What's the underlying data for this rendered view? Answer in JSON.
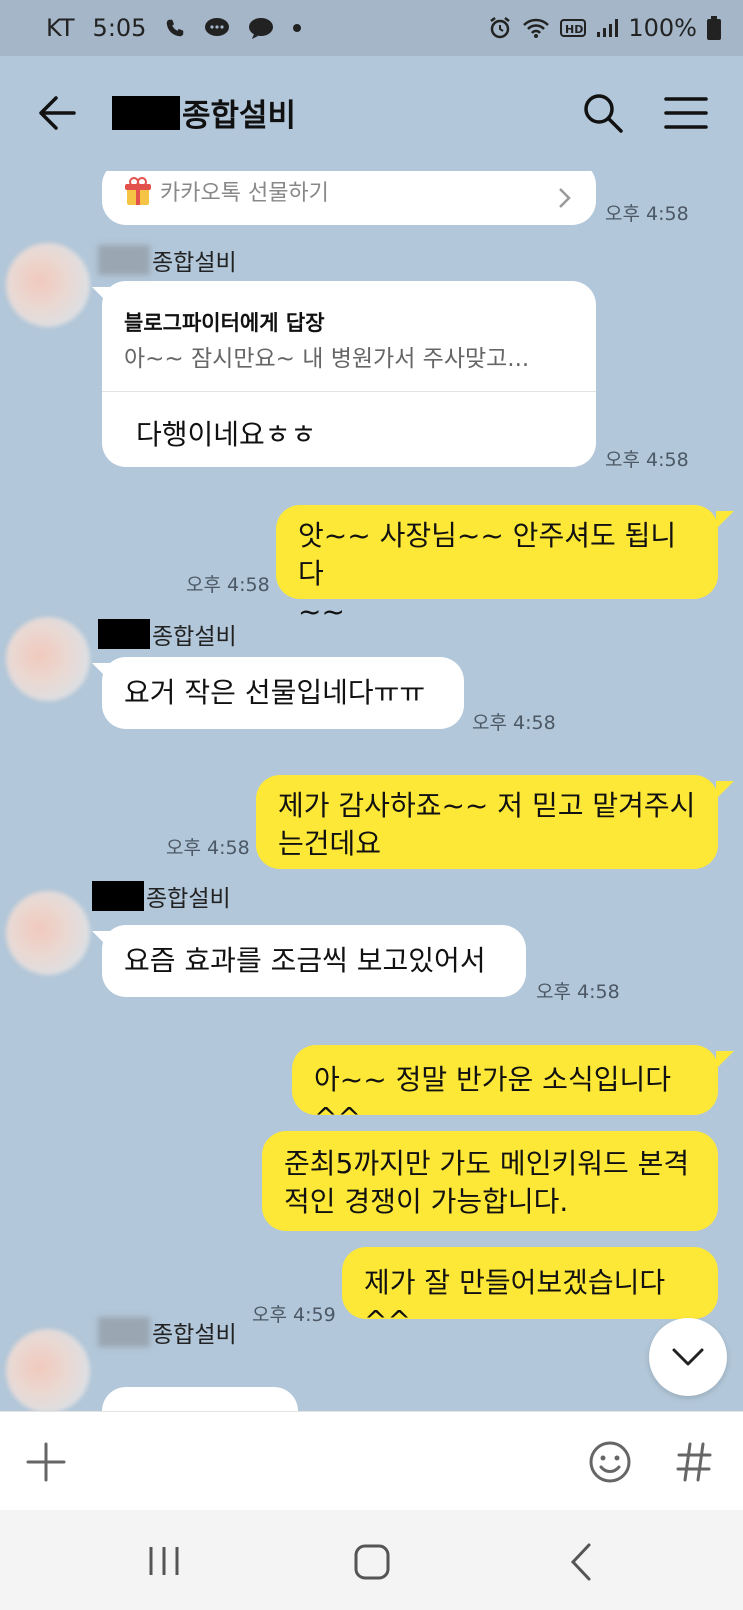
{
  "status_bar": {
    "carrier": "KT",
    "time": "5:05",
    "battery": "100%"
  },
  "header": {
    "room_name": "종합설비"
  },
  "messages": {
    "gift_link": "카카오톡 선물하기",
    "gift_time": "오후 4:58",
    "m1_sender": "종합설비",
    "m1_reply_to": "블로그파이터에게 답장",
    "m1_reply_preview": "아~~ 잠시만요~ 내 병원가서 주사맞고...",
    "m1_text": "다행이네요ㅎㅎ",
    "m1_time": "오후 4:58",
    "m2_line1": "앗~~ 사장님~~ 안주셔도 됩니다",
    "m2_line2": "~~",
    "m2_time": "오후 4:58",
    "m3_sender": "종합설비",
    "m3_text": "요거 작은 선물입네다ㅠㅠ",
    "m3_time": "오후 4:58",
    "m4_line1": "제가 감사하죠~~ 저 믿고 맡겨주시",
    "m4_line2": "는건데요",
    "m4_time": "오후 4:58",
    "m5_sender": "종합설비",
    "m5_text": "요즘 효과를 조금씩 보고있어서",
    "m5_time": "오후 4:58",
    "m6_text": "아~~ 정말 반가운 소식입니다^^",
    "m7_line1": "준최5까지만 가도 메인키워드 본격",
    "m7_line2": "적인 경쟁이 가능합니다.",
    "m8_text": "제가 잘 만들어보겠습니다^^",
    "m8_time": "오후 4:59",
    "m9_sender": "종합설비"
  },
  "icons": {
    "back": "arrow-left-icon",
    "search": "search-icon",
    "menu": "hamburger-menu-icon",
    "plus": "plus-icon",
    "emoji": "emoji-icon",
    "hashtag": "hashtag-icon",
    "scroll_down": "chevron-down-icon",
    "gift": "gift-box-icon"
  },
  "colors": {
    "chat_background": "#b2c7d9",
    "my_bubble": "#fee837",
    "other_bubble": "#ffffff"
  }
}
